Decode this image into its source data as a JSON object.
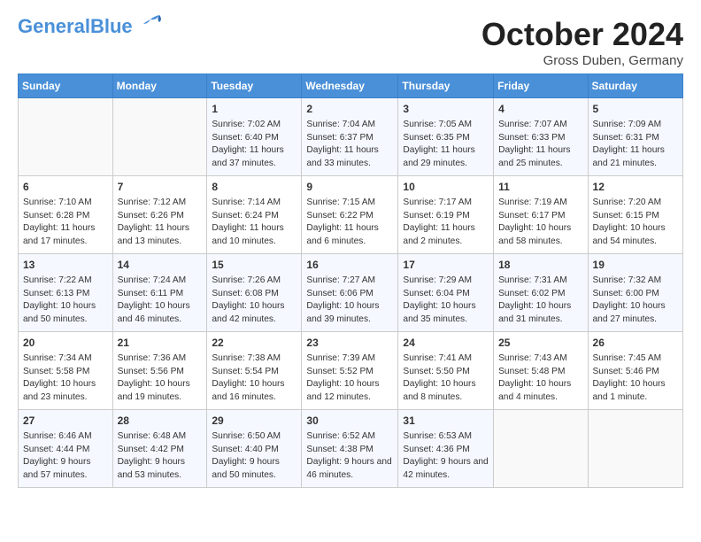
{
  "header": {
    "logo_general": "General",
    "logo_blue": "Blue",
    "month": "October 2024",
    "location": "Gross Duben, Germany"
  },
  "weekdays": [
    "Sunday",
    "Monday",
    "Tuesday",
    "Wednesday",
    "Thursday",
    "Friday",
    "Saturday"
  ],
  "weeks": [
    [
      {
        "day": "",
        "info": ""
      },
      {
        "day": "",
        "info": ""
      },
      {
        "day": "1",
        "info": "Sunrise: 7:02 AM\nSunset: 6:40 PM\nDaylight: 11 hours and 37 minutes."
      },
      {
        "day": "2",
        "info": "Sunrise: 7:04 AM\nSunset: 6:37 PM\nDaylight: 11 hours and 33 minutes."
      },
      {
        "day": "3",
        "info": "Sunrise: 7:05 AM\nSunset: 6:35 PM\nDaylight: 11 hours and 29 minutes."
      },
      {
        "day": "4",
        "info": "Sunrise: 7:07 AM\nSunset: 6:33 PM\nDaylight: 11 hours and 25 minutes."
      },
      {
        "day": "5",
        "info": "Sunrise: 7:09 AM\nSunset: 6:31 PM\nDaylight: 11 hours and 21 minutes."
      }
    ],
    [
      {
        "day": "6",
        "info": "Sunrise: 7:10 AM\nSunset: 6:28 PM\nDaylight: 11 hours and 17 minutes."
      },
      {
        "day": "7",
        "info": "Sunrise: 7:12 AM\nSunset: 6:26 PM\nDaylight: 11 hours and 13 minutes."
      },
      {
        "day": "8",
        "info": "Sunrise: 7:14 AM\nSunset: 6:24 PM\nDaylight: 11 hours and 10 minutes."
      },
      {
        "day": "9",
        "info": "Sunrise: 7:15 AM\nSunset: 6:22 PM\nDaylight: 11 hours and 6 minutes."
      },
      {
        "day": "10",
        "info": "Sunrise: 7:17 AM\nSunset: 6:19 PM\nDaylight: 11 hours and 2 minutes."
      },
      {
        "day": "11",
        "info": "Sunrise: 7:19 AM\nSunset: 6:17 PM\nDaylight: 10 hours and 58 minutes."
      },
      {
        "day": "12",
        "info": "Sunrise: 7:20 AM\nSunset: 6:15 PM\nDaylight: 10 hours and 54 minutes."
      }
    ],
    [
      {
        "day": "13",
        "info": "Sunrise: 7:22 AM\nSunset: 6:13 PM\nDaylight: 10 hours and 50 minutes."
      },
      {
        "day": "14",
        "info": "Sunrise: 7:24 AM\nSunset: 6:11 PM\nDaylight: 10 hours and 46 minutes."
      },
      {
        "day": "15",
        "info": "Sunrise: 7:26 AM\nSunset: 6:08 PM\nDaylight: 10 hours and 42 minutes."
      },
      {
        "day": "16",
        "info": "Sunrise: 7:27 AM\nSunset: 6:06 PM\nDaylight: 10 hours and 39 minutes."
      },
      {
        "day": "17",
        "info": "Sunrise: 7:29 AM\nSunset: 6:04 PM\nDaylight: 10 hours and 35 minutes."
      },
      {
        "day": "18",
        "info": "Sunrise: 7:31 AM\nSunset: 6:02 PM\nDaylight: 10 hours and 31 minutes."
      },
      {
        "day": "19",
        "info": "Sunrise: 7:32 AM\nSunset: 6:00 PM\nDaylight: 10 hours and 27 minutes."
      }
    ],
    [
      {
        "day": "20",
        "info": "Sunrise: 7:34 AM\nSunset: 5:58 PM\nDaylight: 10 hours and 23 minutes."
      },
      {
        "day": "21",
        "info": "Sunrise: 7:36 AM\nSunset: 5:56 PM\nDaylight: 10 hours and 19 minutes."
      },
      {
        "day": "22",
        "info": "Sunrise: 7:38 AM\nSunset: 5:54 PM\nDaylight: 10 hours and 16 minutes."
      },
      {
        "day": "23",
        "info": "Sunrise: 7:39 AM\nSunset: 5:52 PM\nDaylight: 10 hours and 12 minutes."
      },
      {
        "day": "24",
        "info": "Sunrise: 7:41 AM\nSunset: 5:50 PM\nDaylight: 10 hours and 8 minutes."
      },
      {
        "day": "25",
        "info": "Sunrise: 7:43 AM\nSunset: 5:48 PM\nDaylight: 10 hours and 4 minutes."
      },
      {
        "day": "26",
        "info": "Sunrise: 7:45 AM\nSunset: 5:46 PM\nDaylight: 10 hours and 1 minute."
      }
    ],
    [
      {
        "day": "27",
        "info": "Sunrise: 6:46 AM\nSunset: 4:44 PM\nDaylight: 9 hours and 57 minutes."
      },
      {
        "day": "28",
        "info": "Sunrise: 6:48 AM\nSunset: 4:42 PM\nDaylight: 9 hours and 53 minutes."
      },
      {
        "day": "29",
        "info": "Sunrise: 6:50 AM\nSunset: 4:40 PM\nDaylight: 9 hours and 50 minutes."
      },
      {
        "day": "30",
        "info": "Sunrise: 6:52 AM\nSunset: 4:38 PM\nDaylight: 9 hours and 46 minutes."
      },
      {
        "day": "31",
        "info": "Sunrise: 6:53 AM\nSunset: 4:36 PM\nDaylight: 9 hours and 42 minutes."
      },
      {
        "day": "",
        "info": ""
      },
      {
        "day": "",
        "info": ""
      }
    ]
  ]
}
